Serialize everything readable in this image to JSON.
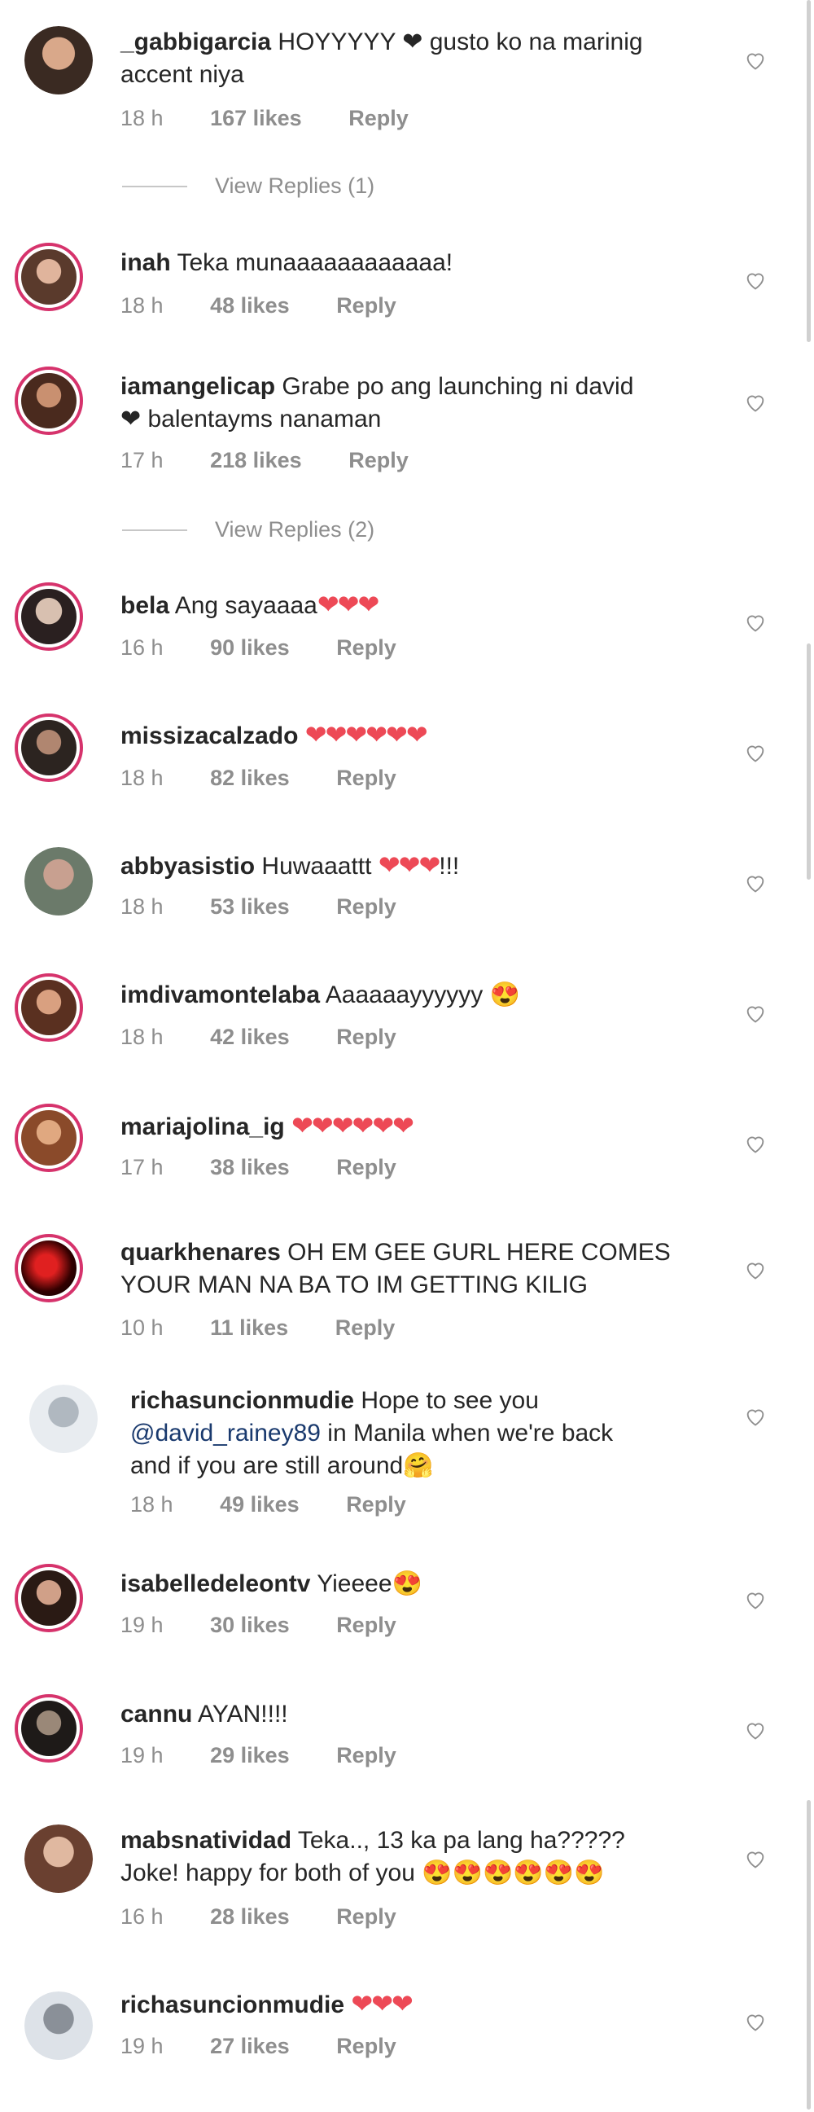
{
  "comments": [
    {
      "user": "_gabbigarcia",
      "text1": "HOYYYYY ❤ gusto ko na marinig",
      "text2": "accent niya",
      "time": "18 h",
      "likes": "167 likes",
      "reply": "Reply"
    },
    {
      "user": "inah",
      "text1": "Teka munaaaaaaaaaaaa!",
      "time": "18 h",
      "likes": "48 likes",
      "reply": "Reply"
    },
    {
      "user": "iamangelicap",
      "text1": "Grabe po ang launching ni david",
      "text2": "❤ balentayms nanaman",
      "time": "17 h",
      "likes": "218 likes",
      "reply": "Reply"
    },
    {
      "user": "bela",
      "text1": "Ang sayaaaa",
      "hearts": "❤❤❤",
      "time": "16 h",
      "likes": "90 likes",
      "reply": "Reply"
    },
    {
      "user": "missizacalzado",
      "hearts": "❤❤❤❤❤❤",
      "time": "18 h",
      "likes": "82 likes",
      "reply": "Reply"
    },
    {
      "user": "abbyasistio",
      "text1": "Huwaaattt",
      "hearts": "❤❤❤",
      "suffix": "!!!",
      "time": "18 h",
      "likes": "53 likes",
      "reply": "Reply"
    },
    {
      "user": "imdivamontelaba",
      "text1": "Aaaaaayyyyyy",
      "emoji": "😍",
      "time": "18 h",
      "likes": "42 likes",
      "reply": "Reply"
    },
    {
      "user": "mariajolina_ig",
      "hearts": "❤❤❤❤❤❤",
      "time": "17 h",
      "likes": "38 likes",
      "reply": "Reply"
    },
    {
      "user": "quarkhenares",
      "text1": "OH EM GEE GURL HERE COMES",
      "text2": "YOUR MAN NA BA TO IM GETTING KILIG",
      "time": "10 h",
      "likes": "11 likes",
      "reply": "Reply"
    },
    {
      "user": "richasuncionmudie",
      "text1": "Hope to see you",
      "mention": "@david_rainey89",
      "text2": "in Manila when we're back",
      "text3": "and if you are still around",
      "emoji": "🤗",
      "time": "18 h",
      "likes": "49 likes",
      "reply": "Reply"
    },
    {
      "user": "isabelledeleontv",
      "text1": "Yieeee",
      "emoji": "😍",
      "time": "19 h",
      "likes": "30 likes",
      "reply": "Reply"
    },
    {
      "user": "cannu",
      "text1": "AYAN!!!!",
      "time": "19 h",
      "likes": "29 likes",
      "reply": "Reply"
    },
    {
      "user": "mabsnatividad",
      "text1": "Teka.., 13 ka pa lang ha?????",
      "text2": "Joke! happy for both of you",
      "emoji": "😍😍😍😍😍😍",
      "time": "16 h",
      "likes": "28 likes",
      "reply": "Reply"
    },
    {
      "user": "richasuncionmudie",
      "hearts": "❤❤❤",
      "time": "19 h",
      "likes": "27 likes",
      "reply": "Reply"
    }
  ],
  "view_replies": [
    "View Replies (1)",
    "View Replies (2)"
  ],
  "colors": {
    "story_ring": "#d6336c",
    "heart": "#ed4956",
    "meta": "#8e8e8e"
  },
  "icons": {
    "like": "heart-outline-icon"
  }
}
